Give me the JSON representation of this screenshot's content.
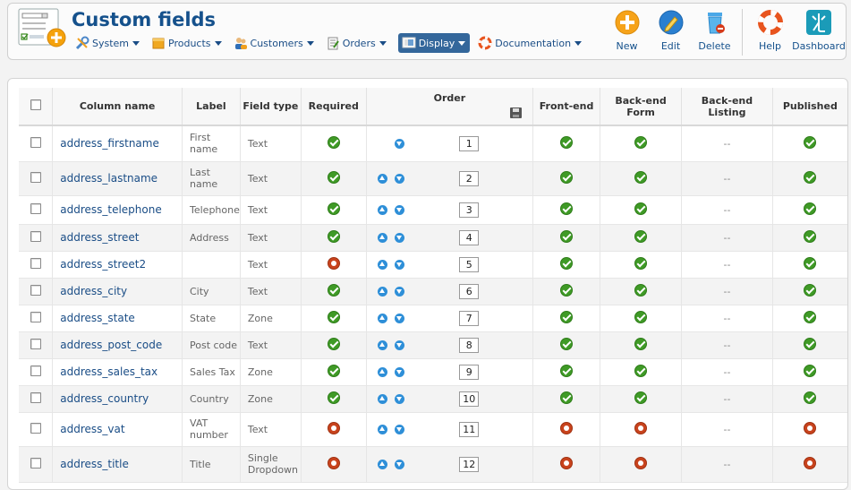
{
  "header": {
    "title": "Custom fields",
    "menu": [
      {
        "id": "system",
        "label": "System",
        "icon": "wrench-icon",
        "active": false
      },
      {
        "id": "products",
        "label": "Products",
        "icon": "products-icon",
        "active": false
      },
      {
        "id": "customers",
        "label": "Customers",
        "icon": "customers-icon",
        "active": false
      },
      {
        "id": "orders",
        "label": "Orders",
        "icon": "orders-icon",
        "active": false
      },
      {
        "id": "display",
        "label": "Display",
        "icon": "display-icon",
        "active": true
      },
      {
        "id": "documentation",
        "label": "Documentation",
        "icon": "lifebuoy-icon",
        "active": false
      }
    ],
    "toolbar": [
      {
        "id": "new",
        "label": "New",
        "icon": "plus-circle-icon"
      },
      {
        "id": "edit",
        "label": "Edit",
        "icon": "pencil-icon"
      },
      {
        "id": "delete",
        "label": "Delete",
        "icon": "trash-icon"
      },
      {
        "id": "help",
        "label": "Help",
        "icon": "lifebuoy-icon"
      },
      {
        "id": "dashboard",
        "label": "Dashboard",
        "icon": "dashboard-icon"
      }
    ]
  },
  "table": {
    "columns": {
      "column_name": "Column name",
      "label": "Label",
      "field_type": "Field type",
      "required": "Required",
      "order": "Order",
      "frontend": "Front-end",
      "backend_form": "Back-end Form",
      "backend_listing": "Back-end Listing",
      "published": "Published"
    },
    "rows": [
      {
        "name": "address_firstname",
        "label": "First name",
        "type": "Text",
        "required": true,
        "order": "1",
        "up": false,
        "down": true,
        "frontend": true,
        "backform": true,
        "listing": "--",
        "published": true
      },
      {
        "name": "address_lastname",
        "label": "Last name",
        "type": "Text",
        "required": true,
        "order": "2",
        "up": true,
        "down": true,
        "frontend": true,
        "backform": true,
        "listing": "--",
        "published": true
      },
      {
        "name": "address_telephone",
        "label": "Telephone",
        "type": "Text",
        "required": true,
        "order": "3",
        "up": true,
        "down": true,
        "frontend": true,
        "backform": true,
        "listing": "--",
        "published": true
      },
      {
        "name": "address_street",
        "label": "Address",
        "type": "Text",
        "required": true,
        "order": "4",
        "up": true,
        "down": true,
        "frontend": true,
        "backform": true,
        "listing": "--",
        "published": true
      },
      {
        "name": "address_street2",
        "label": "",
        "type": "Text",
        "required": false,
        "order": "5",
        "up": true,
        "down": true,
        "frontend": true,
        "backform": true,
        "listing": "--",
        "published": true
      },
      {
        "name": "address_city",
        "label": "City",
        "type": "Text",
        "required": true,
        "order": "6",
        "up": true,
        "down": true,
        "frontend": true,
        "backform": true,
        "listing": "--",
        "published": true
      },
      {
        "name": "address_state",
        "label": "State",
        "type": "Zone",
        "required": true,
        "order": "7",
        "up": true,
        "down": true,
        "frontend": true,
        "backform": true,
        "listing": "--",
        "published": true
      },
      {
        "name": "address_post_code",
        "label": "Post code",
        "type": "Text",
        "required": true,
        "order": "8",
        "up": true,
        "down": true,
        "frontend": true,
        "backform": true,
        "listing": "--",
        "published": true
      },
      {
        "name": "address_sales_tax",
        "label": "Sales Tax",
        "type": "Zone",
        "required": true,
        "order": "9",
        "up": true,
        "down": true,
        "frontend": true,
        "backform": true,
        "listing": "--",
        "published": true
      },
      {
        "name": "address_country",
        "label": "Country",
        "type": "Zone",
        "required": true,
        "order": "10",
        "up": true,
        "down": true,
        "frontend": true,
        "backform": true,
        "listing": "--",
        "published": true
      },
      {
        "name": "address_vat",
        "label": "VAT number",
        "type": "Text",
        "required": false,
        "order": "11",
        "up": true,
        "down": true,
        "frontend": false,
        "backform": false,
        "listing": "--",
        "published": false
      },
      {
        "name": "address_title",
        "label": "Title",
        "type": "Single Dropdown",
        "required": false,
        "order": "12",
        "up": true,
        "down": true,
        "frontend": false,
        "backform": false,
        "listing": "--",
        "published": false
      }
    ]
  }
}
